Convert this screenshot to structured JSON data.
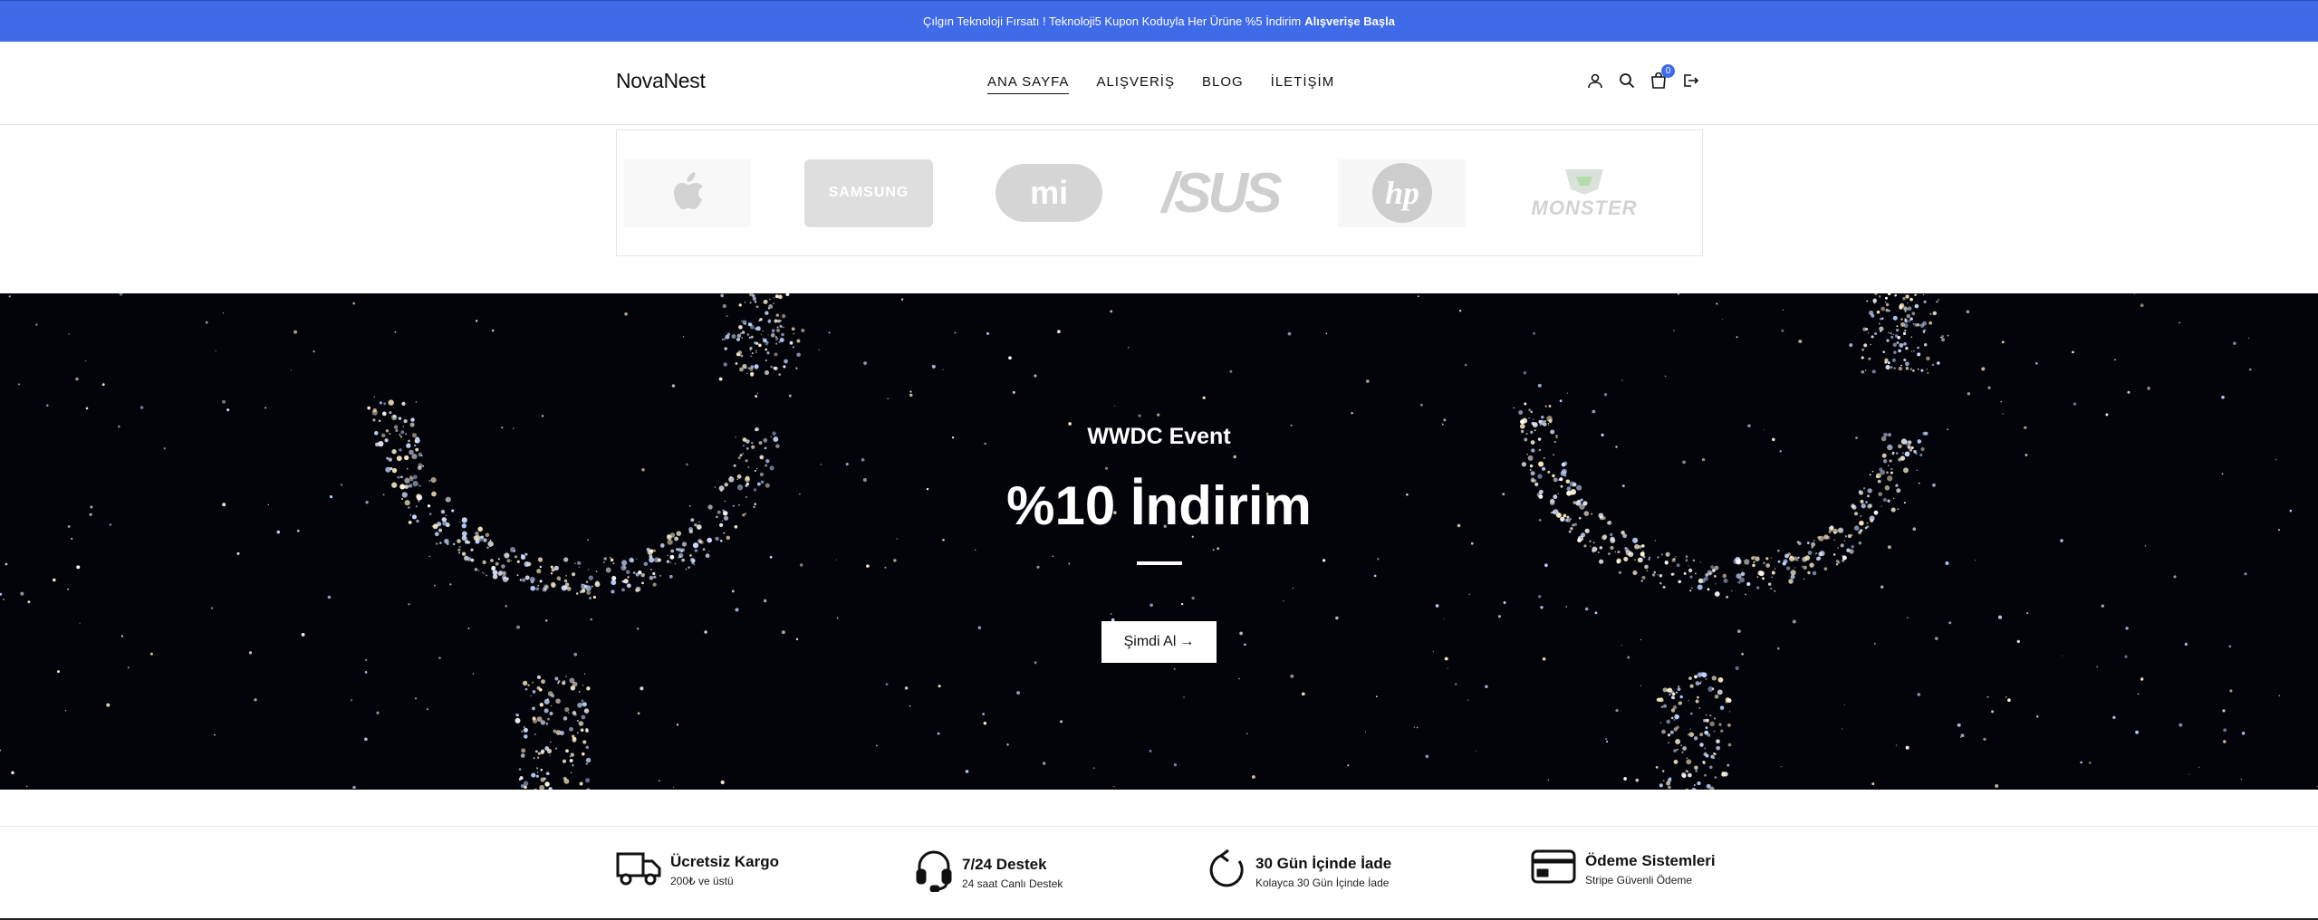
{
  "topbar": {
    "text": "Çılgın Teknoloji Fırsatı ! Teknoloji5 Kupon Koduyla Her Ürüne %5 İndirim",
    "link": "Alışverişe Başla"
  },
  "header": {
    "logo": "NovaNest",
    "nav": [
      "ANA SAYFA",
      "ALIŞVERİŞ",
      "BLOG",
      "İLETİŞİM"
    ],
    "cart_count": "0"
  },
  "brands": {
    "samsung": "SAMSUNG",
    "mi": "mi",
    "asus": "/SUS",
    "hp": "hp",
    "monster": "MONSTER",
    "icons": [
      "apple-logo",
      "samsung-logo",
      "mi-logo",
      "asus-logo",
      "hp-logo",
      "monster-logo"
    ]
  },
  "hero": {
    "event": "WWDC Event",
    "discount": "%10 İndirim",
    "cta": "Şimdi Al"
  },
  "features": [
    {
      "title": "Ücretsiz Kargo",
      "subtitle": "200₺ ve üstü",
      "icon": "truck-icon"
    },
    {
      "title": "7/24 Destek",
      "subtitle": "24 saat Canlı Destek",
      "icon": "headset-icon"
    },
    {
      "title": "30 Gün İçinde İade",
      "subtitle": "Kolayca 30 Gün İçinde İade",
      "icon": "refresh-icon"
    },
    {
      "title": "Ödeme Sistemleri",
      "subtitle": "Stripe Güvenli Ödeme",
      "icon": "credit-card-icon"
    }
  ],
  "colors": {
    "accent": "#3f6ae8",
    "hero_bg": "#03040a"
  }
}
